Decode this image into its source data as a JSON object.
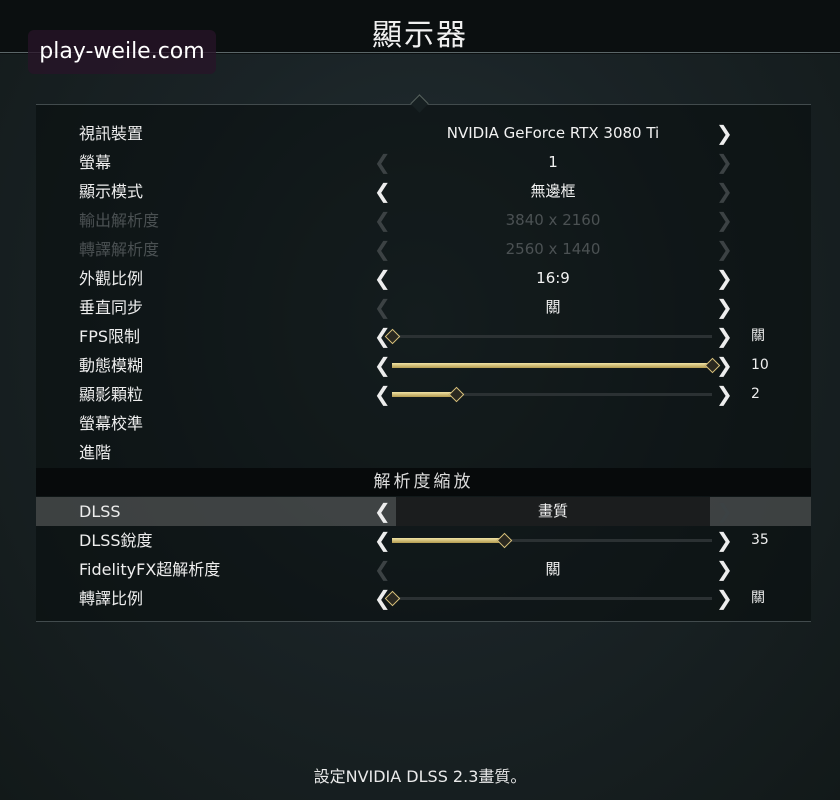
{
  "title": "顯示器",
  "watermark": "play-weile.com",
  "settings": [
    {
      "label": "視訊裝置",
      "value": "NVIDIA GeForce RTX 3080 Ti"
    },
    {
      "label": "螢幕",
      "value": "1"
    },
    {
      "label": "顯示模式",
      "value": "無邊框"
    },
    {
      "label": "輸出解析度",
      "value": "3840 x 2160",
      "disabled": true
    },
    {
      "label": "轉譯解析度",
      "value": "2560 x 1440",
      "disabled": true
    },
    {
      "label": "外觀比例",
      "value": "16:9"
    },
    {
      "label": "垂直同步",
      "value": "關"
    },
    {
      "label": "FPS限制",
      "slider_fraction": 0.0,
      "value": "關"
    },
    {
      "label": "動態模糊",
      "slider_fraction": 1.0,
      "value": "10"
    },
    {
      "label": "顯影顆粒",
      "slider_fraction": 0.2,
      "value": "2"
    },
    {
      "label": "螢幕校準"
    },
    {
      "label": "進階"
    }
  ],
  "section_header": "解析度縮放",
  "scaling": [
    {
      "label": "DLSS",
      "value": "畫質",
      "selected": true
    },
    {
      "label": "DLSS銳度",
      "slider_fraction": 0.35,
      "value": "35"
    },
    {
      "label": "FidelityFX超解析度",
      "value": "關"
    },
    {
      "label": "轉譯比例",
      "slider_fraction": 0.0,
      "value": "關"
    }
  ],
  "footer_hint": "設定NVIDIA DLSS 2.3畫質。",
  "colors": {
    "accent_gold": "#d9c27c",
    "text": "#ededed",
    "disabled": "#4a5052"
  }
}
